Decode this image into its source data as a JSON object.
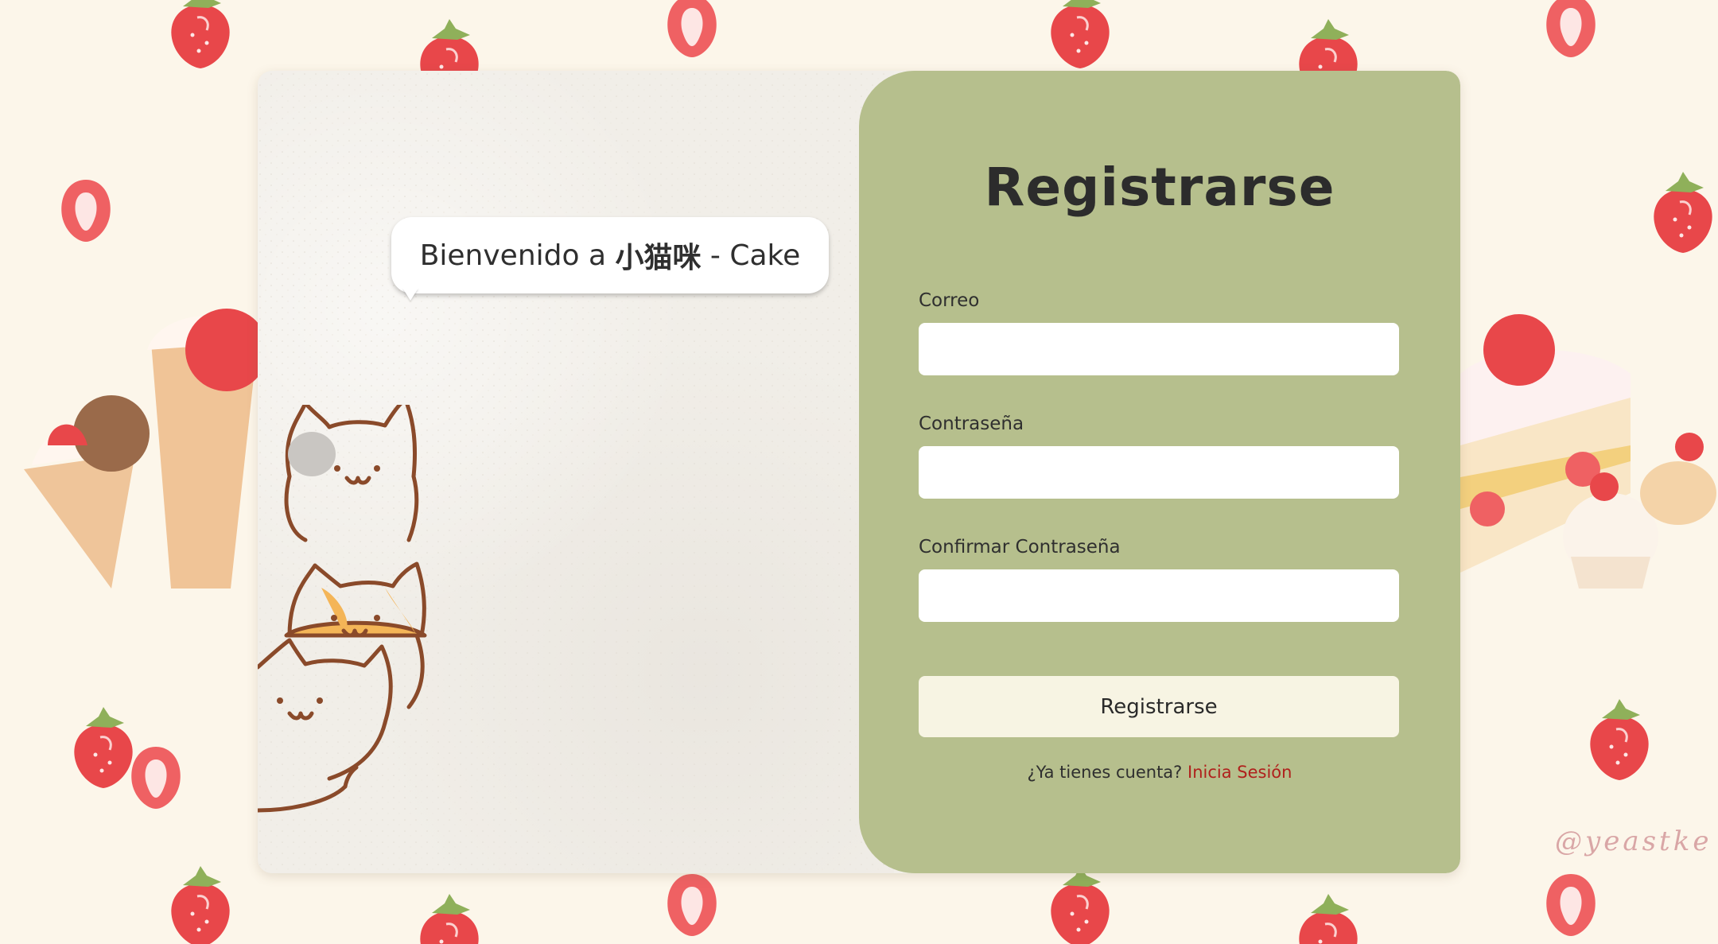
{
  "colors": {
    "page_background": "#fcf6ea",
    "form_panel": "#b6bf8d",
    "submit_button": "#f7f4e3",
    "login_link": "#b0201c",
    "strawberry": "#e8474a",
    "cat_outline": "#8a4a2a"
  },
  "welcome": {
    "prefix": "Bienvenido a ",
    "brand": "小猫咪",
    "suffix": " - Cake"
  },
  "form": {
    "title": "Registrarse",
    "fields": [
      {
        "label": "Correo",
        "value": "",
        "placeholder": "",
        "type": "email"
      },
      {
        "label": "Contraseña",
        "value": "",
        "placeholder": "",
        "type": "password"
      },
      {
        "label": "Confirmar Contraseña",
        "value": "",
        "placeholder": "",
        "type": "password"
      }
    ],
    "submit_label": "Registrarse",
    "login_prompt": "¿Ya tienes cuenta? ",
    "login_link": "Inicia Sesión"
  },
  "background": {
    "watermark": "@yeastke",
    "decorations": [
      "strawberry-icon",
      "crepe-illustration",
      "cake-slice-illustration",
      "cupcake-illustration"
    ]
  },
  "illustration": {
    "cats": [
      "calico-cat",
      "orange-cat",
      "white-cat"
    ]
  }
}
